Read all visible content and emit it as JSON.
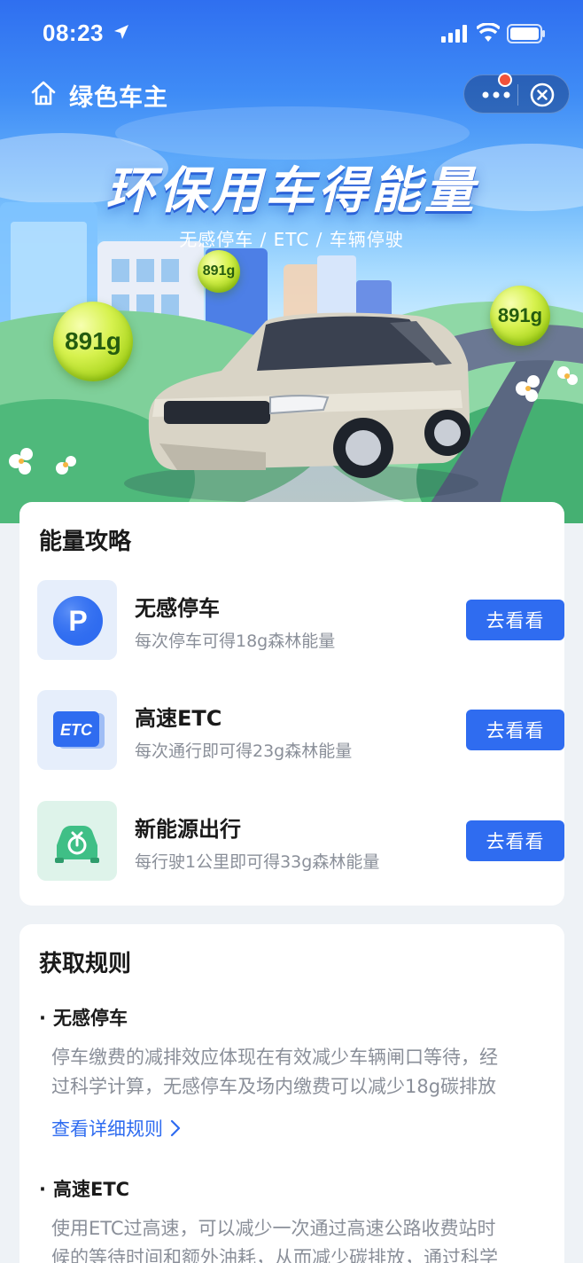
{
  "status_bar": {
    "time": "08:23"
  },
  "nav": {
    "title": "绿色车主"
  },
  "hero": {
    "title": "环保用车得能量",
    "subtitle": "无感停车 / ETC / 车辆停驶",
    "bubbles": [
      "891g",
      "891g",
      "891g"
    ]
  },
  "strategy": {
    "title": "能量攻略",
    "items": [
      {
        "name": "无感停车",
        "desc": "每次停车可得18g森林能量",
        "button": "去看看",
        "icon": "parking-icon"
      },
      {
        "name": "高速ETC",
        "desc": "每次通行即可得23g森林能量",
        "button": "去看看",
        "icon": "etc-icon"
      },
      {
        "name": "新能源出行",
        "desc": "每行驶1公里即可得33g森林能量",
        "button": "去看看",
        "icon": "ev-car-icon"
      }
    ]
  },
  "rules": {
    "title": "获取规则",
    "sections": [
      {
        "heading": "无感停车",
        "line1": "停车缴费的减排效应体现在有效减少车辆闸口等待，经",
        "line2": "过科学计算，无感停车及场内缴费可以减少18g碳排放",
        "link": "查看详细规则"
      },
      {
        "heading": "高速ETC",
        "line1": "使用ETC过高速，可以减少一次通过高速公路收费站时",
        "line2": "候的等待时间和额外油耗，从而减少碳排放，通过科学"
      }
    ]
  },
  "colors": {
    "primary": "#2f6cf0",
    "muted_text": "#8a8f99",
    "energy_bubble": "#c8e83a"
  }
}
